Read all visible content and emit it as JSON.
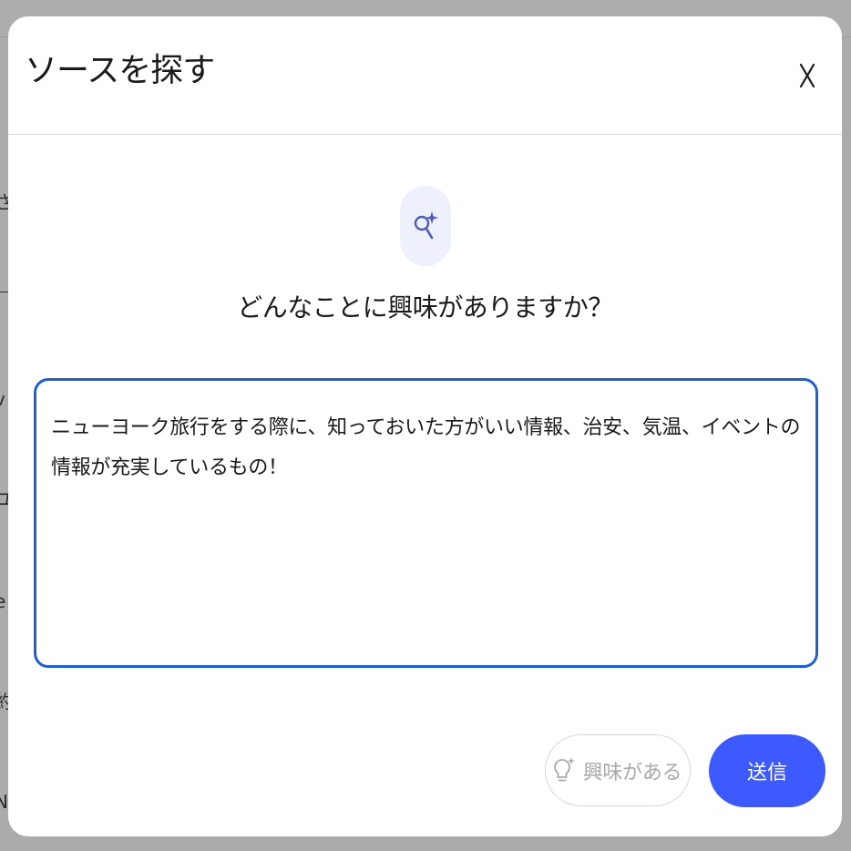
{
  "background": {
    "fragments": [
      "さ",
      "v",
      "ユ",
      "e",
      "約",
      "N'"
    ]
  },
  "dialog": {
    "title": "ソースを探す",
    "close_icon": "close-icon",
    "close_glyph": "X",
    "badge_icon": "sparkle-search-icon",
    "question": "どんなことに興味がありますか？",
    "query_text": "ニューヨーク旅行をする際に、知っておいた方がいい情報、治安、気温、イベントの情報が充実しているもの！",
    "interest_button": {
      "icon": "lightbulb-sparkle-icon",
      "label": "興味がある"
    },
    "submit_label": "送信"
  },
  "colors": {
    "accent": "#3d5afe",
    "focus_border": "#1f5fd1",
    "badge_bg": "#eef0fb",
    "icon_blue": "#4f5bb8",
    "disabled_text": "#a8a8a8",
    "overlay": "#ababab"
  }
}
